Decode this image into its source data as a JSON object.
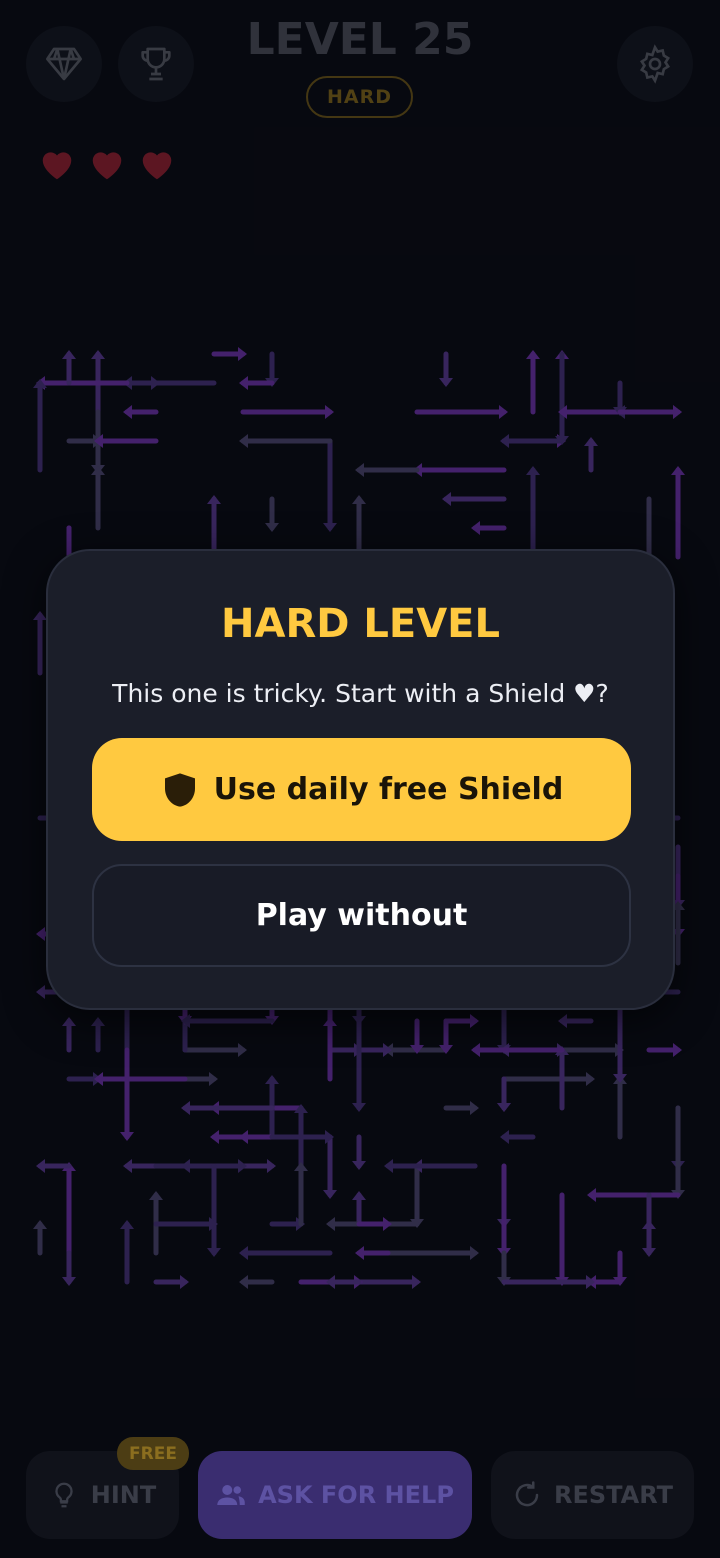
{
  "header": {
    "level_title": "LEVEL 25",
    "difficulty": "HARD",
    "lives": 3,
    "icons": [
      "gem-icon",
      "trophy-icon",
      "gear-icon"
    ]
  },
  "modal": {
    "title": "HARD LEVEL",
    "message": "This one is tricky. Start with a Shield ♥?",
    "primary_label": "Use daily free Shield",
    "secondary_label": "Play without"
  },
  "bottom_bar": {
    "free_badge": "FREE",
    "hint_label": "HINT",
    "help_label": "ASK FOR HELP",
    "restart_label": "RESTART"
  },
  "colors": {
    "accent_yellow": "#ffc940",
    "heart_red": "#7a1b2a",
    "maze_purple": "#5a2a8c",
    "maze_gray": "#3f3a5c"
  }
}
